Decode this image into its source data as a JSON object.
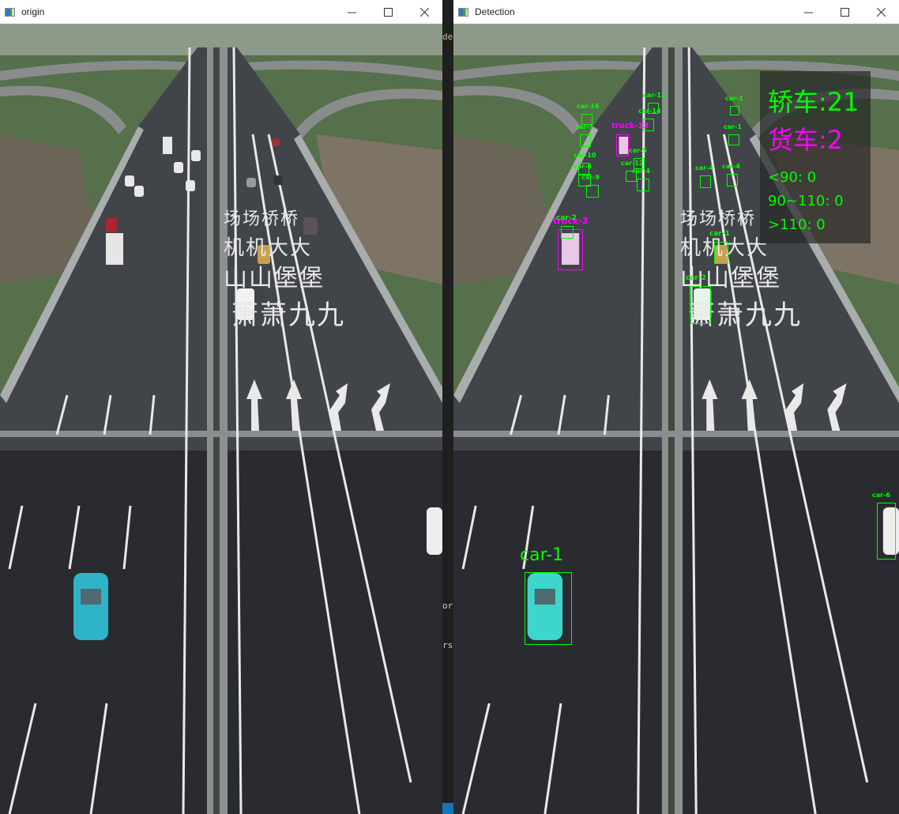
{
  "windows": {
    "origin": {
      "title": "origin",
      "controls": {
        "minimize": "minimize",
        "maximize": "maximize",
        "close": "close"
      }
    },
    "detection": {
      "title": "Detection",
      "controls": {
        "minimize": "minimize",
        "maximize": "maximize",
        "close": "close"
      }
    }
  },
  "road_markings": {
    "row1": "场场桥桥",
    "row2": "机机大大",
    "row3": "山山堡堡",
    "row4": "萧萧九九"
  },
  "stats_panel": {
    "car_count_label": "轿车:21",
    "truck_count_label": "货车:2",
    "speed_lt90": "<90: 0",
    "speed_90_110": "90~110: 0",
    "speed_gt110": ">110: 0"
  },
  "colors": {
    "car_box": "#00ff00",
    "truck_box": "#ff00ff",
    "panel_bg": "#282828"
  },
  "detections": [
    {
      "label": "car-1",
      "class": "car"
    },
    {
      "label": "car-2",
      "class": "car"
    },
    {
      "label": "truck-3",
      "class": "truck"
    },
    {
      "label": "car-1",
      "class": "car"
    },
    {
      "label": "car-2",
      "class": "car"
    },
    {
      "label": "car-6",
      "class": "car"
    },
    {
      "label": "car-7",
      "class": "car"
    },
    {
      "label": "car-10",
      "class": "car"
    },
    {
      "label": "car-8",
      "class": "car"
    },
    {
      "label": "car-9",
      "class": "car"
    },
    {
      "label": "car-5",
      "class": "car"
    },
    {
      "label": "car-4",
      "class": "car"
    },
    {
      "label": "car-11",
      "class": "car"
    },
    {
      "label": "car-14",
      "class": "car"
    },
    {
      "label": "truck-13",
      "class": "truck"
    },
    {
      "label": "car-12",
      "class": "car"
    },
    {
      "label": "car-16",
      "class": "car"
    },
    {
      "label": "car-1",
      "class": "car"
    },
    {
      "label": "car-1",
      "class": "car"
    },
    {
      "label": "car-4",
      "class": "car"
    },
    {
      "label": "car-4",
      "class": "car"
    }
  ],
  "side_strip": {
    "frag1": "de",
    "frag2": "or",
    "frag3": "rs"
  }
}
